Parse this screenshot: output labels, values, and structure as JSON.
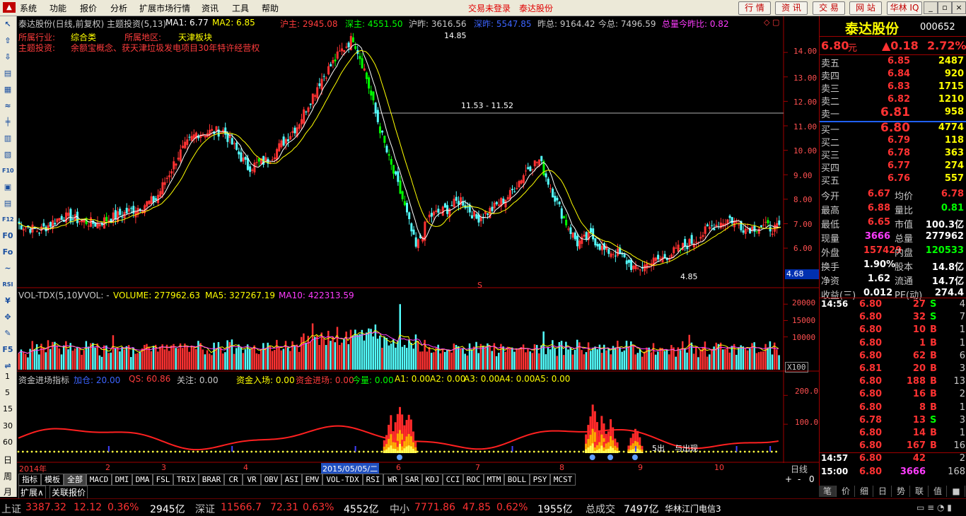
{
  "menu": {
    "items": [
      "系统",
      "功能",
      "报价",
      "分析",
      "扩展市场行情",
      "资讯",
      "工具",
      "帮助"
    ],
    "notice_login": "交易未登录",
    "notice_stock": "泰达股份",
    "top_buttons": [
      "行 情",
      "资 讯",
      "交 易",
      "网 站",
      "华林 IQ"
    ]
  },
  "left_tools": [
    "↖",
    "⇧",
    "⇩",
    "▤",
    "▦",
    "≈",
    "╪",
    "▥",
    "▧",
    "F10",
    "▣",
    "▤",
    "F12",
    "F0",
    "Fo",
    "~",
    "RSI",
    "¥",
    "✥",
    "✎",
    "F5",
    "⇌"
  ],
  "chart_header": {
    "title": "泰达股份(日线,前复权) 主题投资(5,13)",
    "ma1": "MA1: 6.77",
    "ma2": "MA2: 6.85",
    "hu": "沪主: 2945.08",
    "shen": "深主: 4551.50",
    "huzuo": "沪昨: 3616.56",
    "shenzuo": "深昨: 5547.85",
    "zuozong": "昨总: 9164.42",
    "jinzong": "今总: 7496.59",
    "zongliang": "总量今昨比: 0.82",
    "industry_label": "所属行业:",
    "industry": "综合类",
    "region_label": "所属地区:",
    "region": "天津板块",
    "theme_label": "主题投资:",
    "theme": "余额宝概念、获天津垃圾发电项目30年特许经营权",
    "hi_label": "14.85",
    "lo_label": "4.85",
    "line_label": "11.53 - 11.52",
    "cur_price_tag": "4.68",
    "s_mark": "S"
  },
  "price_axis": [
    "14.00",
    "13.00",
    "12.00",
    "11.00",
    "10.00",
    "9.00",
    "8.00",
    "7.00",
    "6.00"
  ],
  "vol_header": {
    "name": "VOL-TDX(5,10)",
    "vvol": "VVOL: -",
    "volume": "VOLUME: 277962.63",
    "ma5": "MA5: 327267.19",
    "ma10": "MA10: 422313.59"
  },
  "vol_axis": [
    "20000",
    "15000",
    "10000"
  ],
  "vol_unit": "X100",
  "fund_header": {
    "name": "资金进场指标",
    "jiacang": "加仓: 20.00",
    "qs": "QS: 60.86",
    "guanzhu": "关注: 0.00",
    "zjrc": "资金入场: 0.00",
    "zjjc": "资金进场: 0.00",
    "jl": "今量: 0.00",
    "a1": "A1: 0.00",
    "a2": "A2: 0.00",
    "a3": "A3: 0.00",
    "a4": "A4: 0.00",
    "a5": "A5: 0.00",
    "chu1": "5出",
    "chu2": "与出现"
  },
  "fund_axis": [
    "200.0",
    "100.0"
  ],
  "side_periods": [
    "1",
    "5",
    "15",
    "30",
    "60",
    "日",
    "周",
    "月"
  ],
  "date_bar": {
    "year": "2014年",
    "months": [
      "2",
      "3",
      "4",
      "5",
      "6",
      "7",
      "8",
      "9",
      "10"
    ],
    "cursor_date": "2015/05/05/二",
    "period": "日线"
  },
  "indicator_tabs": [
    "指标",
    "模板",
    "全部",
    "MACD",
    "DMI",
    "DMA",
    "FSL",
    "TRIX",
    "BRAR",
    "CR",
    "VR",
    "OBV",
    "ASI",
    "EMV",
    "VOL-TDX",
    "RSI",
    "WR",
    "SAR",
    "KDJ",
    "CCI",
    "ROC",
    "MTM",
    "BOLL",
    "PSY",
    "MCST"
  ],
  "ext_tabs": [
    "扩展∧",
    "关联报价"
  ],
  "zoom": [
    "+",
    "-",
    "0"
  ],
  "quote": {
    "name": "泰达股份",
    "code": "000652",
    "price": "6.80",
    "unit": "元",
    "change": "▲0.18",
    "pct": "2.72%",
    "asks": [
      {
        "label": "卖五",
        "price": "6.85",
        "vol": "2487"
      },
      {
        "label": "卖四",
        "price": "6.84",
        "vol": "920"
      },
      {
        "label": "卖三",
        "price": "6.83",
        "vol": "1715"
      },
      {
        "label": "卖二",
        "price": "6.82",
        "vol": "1210"
      },
      {
        "label": "卖一",
        "price": "6.81",
        "vol": "958"
      }
    ],
    "bids": [
      {
        "label": "买一",
        "price": "6.80",
        "vol": "4774"
      },
      {
        "label": "买二",
        "price": "6.79",
        "vol": "118"
      },
      {
        "label": "买三",
        "price": "6.78",
        "vol": "363"
      },
      {
        "label": "买四",
        "price": "6.77",
        "vol": "274"
      },
      {
        "label": "买五",
        "price": "6.76",
        "vol": "557"
      }
    ],
    "stats": [
      {
        "k1": "今开",
        "v1": "6.67",
        "k2": "均价",
        "v2": "6.78"
      },
      {
        "k1": "最高",
        "v1": "6.88",
        "k2": "量比",
        "v2": "0.81"
      },
      {
        "k1": "最低",
        "v1": "6.65",
        "k2": "市值",
        "v2": "100.3亿"
      },
      {
        "k1": "现量",
        "v1": "3666",
        "k2": "总量",
        "v2": "277962"
      },
      {
        "k1": "外盘",
        "v1": "157429",
        "k2": "内盘",
        "v2": "120533"
      },
      {
        "k1": "换手",
        "v1": "1.90%",
        "k2": "股本",
        "v2": "14.8亿"
      },
      {
        "k1": "净资",
        "v1": "1.62",
        "k2": "流通",
        "v2": "14.7亿"
      },
      {
        "k1": "收益(三)",
        "v1": "0.012",
        "k2": "PE(动)",
        "v2": "274.4"
      }
    ],
    "ticks": [
      {
        "t": "14:56",
        "p": "6.80",
        "v": "27",
        "bs": "S",
        "n": "4"
      },
      {
        "t": "",
        "p": "6.80",
        "v": "32",
        "bs": "S",
        "n": "7"
      },
      {
        "t": "",
        "p": "6.80",
        "v": "10",
        "bs": "B",
        "n": "1"
      },
      {
        "t": "",
        "p": "6.80",
        "v": "1",
        "bs": "B",
        "n": "1"
      },
      {
        "t": "",
        "p": "6.80",
        "v": "62",
        "bs": "B",
        "n": "6"
      },
      {
        "t": "",
        "p": "6.81",
        "v": "20",
        "bs": "B",
        "n": "3"
      },
      {
        "t": "",
        "p": "6.80",
        "v": "188",
        "bs": "B",
        "n": "13"
      },
      {
        "t": "",
        "p": "6.80",
        "v": "16",
        "bs": "B",
        "n": "2"
      },
      {
        "t": "",
        "p": "6.80",
        "v": "8",
        "bs": "B",
        "n": "1"
      },
      {
        "t": "",
        "p": "6.78",
        "v": "13",
        "bs": "S",
        "n": "3"
      },
      {
        "t": "",
        "p": "6.80",
        "v": "14",
        "bs": "B",
        "n": "1"
      },
      {
        "t": "",
        "p": "6.80",
        "v": "167",
        "bs": "B",
        "n": "16"
      },
      {
        "t": "14:57",
        "p": "6.80",
        "v": "42",
        "bs": "",
        "n": "2"
      },
      {
        "t": "15:00",
        "p": "6.80",
        "v": "3666",
        "bs": "",
        "n": "168"
      }
    ],
    "bottom_tabs": [
      "笔",
      "价",
      "细",
      "日",
      "势",
      "联",
      "值",
      "■"
    ]
  },
  "status": {
    "sh_name": "上证",
    "sh_val": "3387.32",
    "sh_chg": "12.12",
    "sh_pct": "0.36%",
    "sh_amt": "2945亿",
    "sz_name": "深证",
    "sz_val": "11566.7",
    "sz_chg": "72.31",
    "sz_pct": "0.63%",
    "sz_amt": "4552亿",
    "zx_name": "中小",
    "zx_val": "7771.86",
    "zx_chg": "47.85",
    "zx_pct": "0.62%",
    "zx_amt": "1955亿",
    "total_label": "总成交",
    "total": "7497亿",
    "server": "华林江门电信3"
  },
  "colors": {
    "up": "#ff3232",
    "down": "#54ffff",
    "down_big": "#00ff00",
    "ma1": "#ffffff",
    "ma2": "#ffff00",
    "bg": "#000000"
  },
  "chart_data": {
    "type": "candlestick",
    "ylim": [
      4.5,
      14.9
    ],
    "hi": 14.85,
    "lo": 4.85,
    "line_value": 11.52,
    "anchors": [
      [
        0,
        7.0
      ],
      [
        10,
        6.7
      ],
      [
        20,
        7.3
      ],
      [
        35,
        7.0
      ],
      [
        50,
        7.5
      ],
      [
        62,
        8.0
      ],
      [
        72,
        9.8
      ],
      [
        80,
        10.7
      ],
      [
        92,
        10.8
      ],
      [
        103,
        9.3
      ],
      [
        112,
        9.6
      ],
      [
        125,
        11.0
      ],
      [
        135,
        12.8
      ],
      [
        145,
        14.1
      ],
      [
        150,
        14.6
      ],
      [
        155,
        13.3
      ],
      [
        160,
        11.5
      ],
      [
        166,
        9.6
      ],
      [
        172,
        8.0
      ],
      [
        178,
        6.0
      ],
      [
        184,
        7.3
      ],
      [
        192,
        7.6
      ],
      [
        198,
        8.0
      ],
      [
        205,
        7.2
      ],
      [
        212,
        7.6
      ],
      [
        220,
        8.2
      ],
      [
        228,
        9.3
      ],
      [
        233,
        9.6
      ],
      [
        238,
        8.5
      ],
      [
        244,
        7.2
      ],
      [
        250,
        6.2
      ],
      [
        256,
        6.5
      ],
      [
        262,
        5.9
      ],
      [
        268,
        5.8
      ],
      [
        276,
        5.1
      ],
      [
        282,
        5.4
      ],
      [
        288,
        5.6
      ],
      [
        296,
        6.0
      ],
      [
        302,
        6.3
      ],
      [
        310,
        6.9
      ],
      [
        318,
        7.2
      ],
      [
        325,
        6.8
      ],
      [
        332,
        6.9
      ],
      [
        338,
        6.8
      ]
    ],
    "vol_ylim": [
      0,
      22000
    ],
    "fund_ylim": [
      0,
      240
    ]
  }
}
